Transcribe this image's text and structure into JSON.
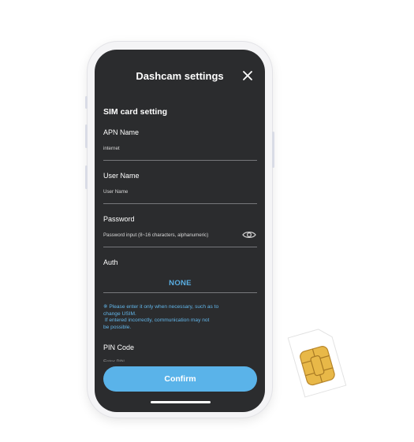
{
  "header": {
    "title": "Dashcam settings"
  },
  "sim_section": {
    "title": "SIM card setting",
    "apn": {
      "label": "APN Name",
      "value": "internet"
    },
    "user_name": {
      "label": "User Name",
      "placeholder": "User Name"
    },
    "password": {
      "label": "Password",
      "placeholder": "Password input (8~16 characters, alphanumeric)"
    },
    "auth": {
      "label": "Auth",
      "value": "NONE"
    },
    "note_lines": [
      "※ Please enter it only when necessary, such as to",
      "change USIM.",
      " If entered incorrectly, communication may not",
      "be possible."
    ],
    "pin": {
      "label": "PIN Code",
      "placeholder": "Enter PIN"
    }
  },
  "footer": {
    "confirm_label": "Confirm"
  },
  "colors": {
    "screen_background": "#2b2c2e",
    "accent": "#5ab3e9",
    "note_text": "#62b6ea"
  },
  "icons": [
    "close-icon",
    "eye-icon",
    "sim-card-icon"
  ]
}
